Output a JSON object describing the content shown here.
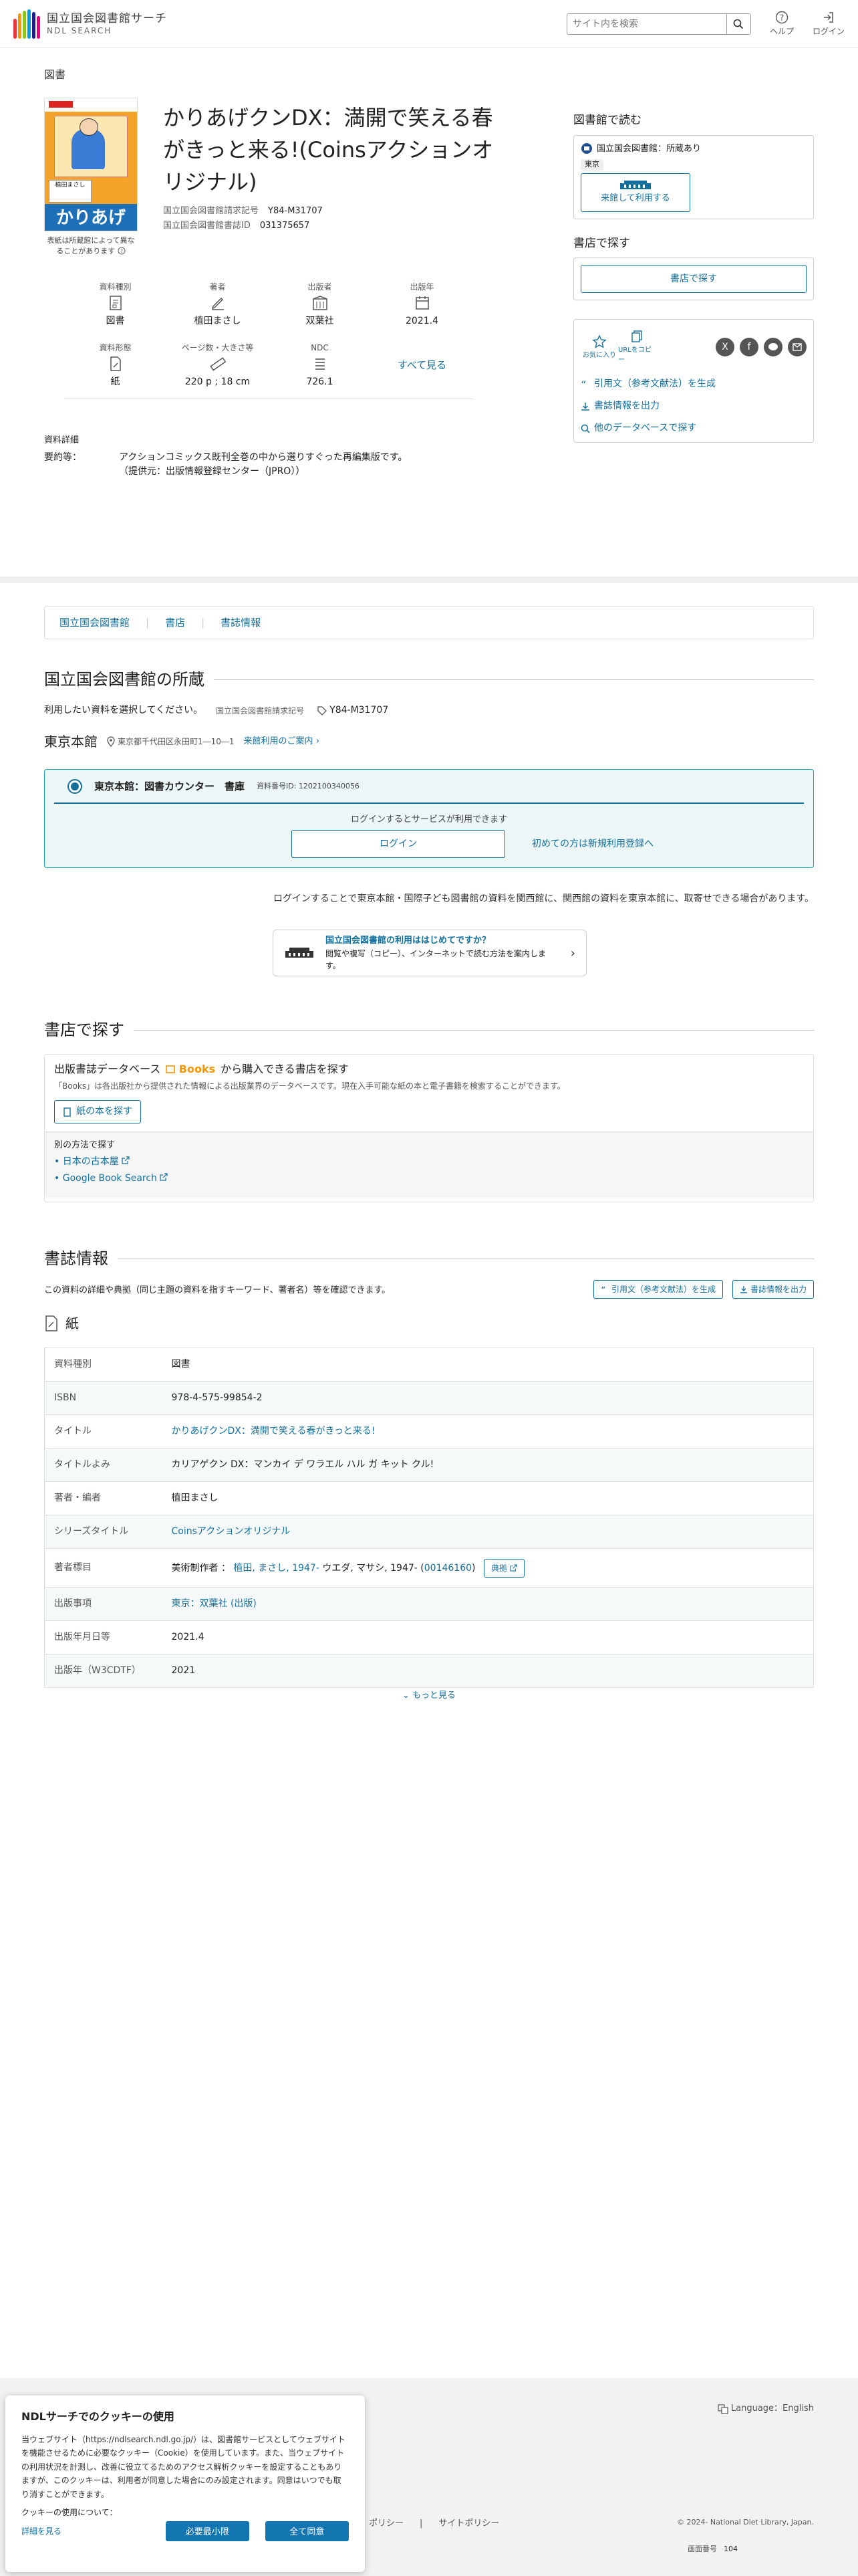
{
  "header": {
    "logo_line1": "国立国会図書館サーチ",
    "logo_line2": "NDL SEARCH",
    "search_placeholder": "サイト内を検索",
    "help_label": "ヘルプ",
    "login_label": "ログイン"
  },
  "record": {
    "type_label": "図書",
    "title": "かりあげクンDX：満開で笑える春がきっと来る!(Coinsアクションオリジナル)",
    "call_no_label": "国立国会図書館請求記号",
    "call_no": "Y84-M31707",
    "bib_id_label": "国立国会図書館書誌ID",
    "bib_id": "031375657",
    "cover_note": "表紙は所蔵館によって異なることがあります",
    "cover_text": "かりあげ",
    "cover_author": "植田まさし"
  },
  "attributes": [
    {
      "label": "資料種別",
      "value": "図書",
      "icon": "book-type-icon"
    },
    {
      "label": "著者",
      "value": "植田まさし",
      "icon": "author-pen-icon"
    },
    {
      "label": "出版者",
      "value": "双葉社",
      "icon": "publisher-building-icon"
    },
    {
      "label": "出版年",
      "value": "2021.4",
      "icon": "calendar-icon"
    },
    {
      "label": "資料形態",
      "value": "紙",
      "icon": "paper-icon"
    },
    {
      "label": "ページ数・大きさ等",
      "value": "220 p ; 18 cm",
      "icon": "ruler-icon"
    },
    {
      "label": "NDC",
      "value": "726.1",
      "icon": "ndc-list-icon"
    }
  ],
  "see_all": "すべて見る",
  "details": {
    "heading": "資料詳細",
    "summary_label": "要約等：",
    "summary_line1": "アクションコミックス既刊全巻の中から選りすぐった再編集版です。",
    "summary_line2": "（提供元：出版情報登録センター（JPRO））"
  },
  "sidebar": {
    "read_heading": "図書館で読む",
    "holding_text": "国立国会図書館：所蔵あり",
    "tag": "東京",
    "visit_button": "来館して利用する",
    "shop_heading": "書店で探す",
    "shop_button": "書店で探す",
    "favorite_label": "お気に入り",
    "copy_url_label": "URLをコピー",
    "cite_link": "引用文（参考文献法）を生成",
    "export_link": "書誌情報を出力",
    "other_db_link": "他のデータベースで探す"
  },
  "breadcrumb_tabs": [
    "国立国会図書館",
    "書店",
    "書誌情報"
  ],
  "holdings": {
    "heading": "国立国会図書館の所蔵",
    "instruction": "利用したい資料を選択してください。",
    "call_no_label": "国立国会図書館請求記号",
    "call_no": "Y84-M31707",
    "branch": "東京本館",
    "address": "東京都千代田区永田町1―10―1",
    "visit_guide": "来館利用のご案内",
    "item_title": "東京本館：図書カウンター　書庫",
    "item_id": "資料番号ID: 1202100340056",
    "login_prompt": "ログインするとサービスが利用できます",
    "login_button": "ログイン",
    "register_link": "初めての方は新規利用登録へ",
    "note": "ログインすることで東京本館・国際子ども図書館の資料を関西館に、関西館の資料を東京本館に、取寄せできる場合があります。",
    "guide_title": "国立国会図書館の利用ははじめてですか？",
    "guide_sub": "閲覧や複写（コピー）、インターネットで読む方法を案内します。"
  },
  "bookstore": {
    "heading": "書店で探す",
    "db_text_before": "出版書誌データベース",
    "db_name": "Books",
    "db_text_after": "から購入できる書店を探す",
    "db_note": "「Books」は各出版社から提供された情報による出版業界のデータベースです。現在入手可能な紙の本と電子書籍を検索することができます。",
    "paper_button": "紙の本を探す",
    "other_heading": "別の方法で探す",
    "other_links": [
      "日本の古本屋",
      "Google Book Search"
    ]
  },
  "biblio": {
    "heading": "書誌情報",
    "intro": "この資料の詳細や典拠（同じ主題の資料を指すキーワード、著者名）等を確認できます。",
    "cite_button": "引用文（参考文献法）を生成",
    "export_button": "書誌情報を出力",
    "format": "紙",
    "rows": [
      {
        "k": "資料種別",
        "v": "図書"
      },
      {
        "k": "ISBN",
        "v": "978-4-575-99854-2"
      },
      {
        "k": "タイトル",
        "v": "かりあげクンDX：満開で笑える春がきっと来る!"
      },
      {
        "k": "タイトルよみ",
        "v": "カリアゲクン DX：マンカイ デ ワラエル ハル ガ キット クル!"
      },
      {
        "k": "著者・編者",
        "v": "植田まさし"
      },
      {
        "k": "シリーズタイトル",
        "v": "Coinsアクションオリジナル"
      },
      {
        "k": "著者標目",
        "v": ""
      },
      {
        "k": "出版事項",
        "v": "東京：双葉社 (出版)"
      },
      {
        "k": "出版年月日等",
        "v": "2021.4"
      },
      {
        "k": "出版年（W3CDTF）",
        "v": "2021"
      }
    ],
    "author_heading_prefix": "美術制作者 ：",
    "author_heading_link": "植田, まさし, 1947-",
    "author_heading_reading": "ウエダ, マサシ, 1947-",
    "author_heading_id": "00146160",
    "authority_button": "典拠",
    "more": "もっと見る"
  },
  "footer": {
    "language": "Language：English",
    "policy1": "ポリシー",
    "policy2": "サイトポリシー",
    "copyright": "© 2024- National Diet Library, Japan.",
    "page_no_label": "画面番号",
    "page_no": "104"
  },
  "cookie": {
    "title": "NDLサーチでのクッキーの使用",
    "body": "当ウェブサイト（https://ndlsearch.ndl.go.jp/）は、図書館サービスとしてウェブサイトを機能させるために必要なクッキー（Cookie）を使用しています。また、当ウェブサイトの利用状況を計測し、改善に役立てるためのアクセス解析クッキーを設定することもありますが、このクッキーは、利用者が同意した場合にのみ設定されます。同意はいつでも取り消すことができます。",
    "more_label": "クッキーの使用について：",
    "more_link": "詳細を見る",
    "minimum_button": "必要最小限",
    "accept_button": "全て同意"
  },
  "colors": {
    "accent": "#13709d",
    "teal_border": "#13a6a6",
    "books_orange": "#f39800"
  }
}
